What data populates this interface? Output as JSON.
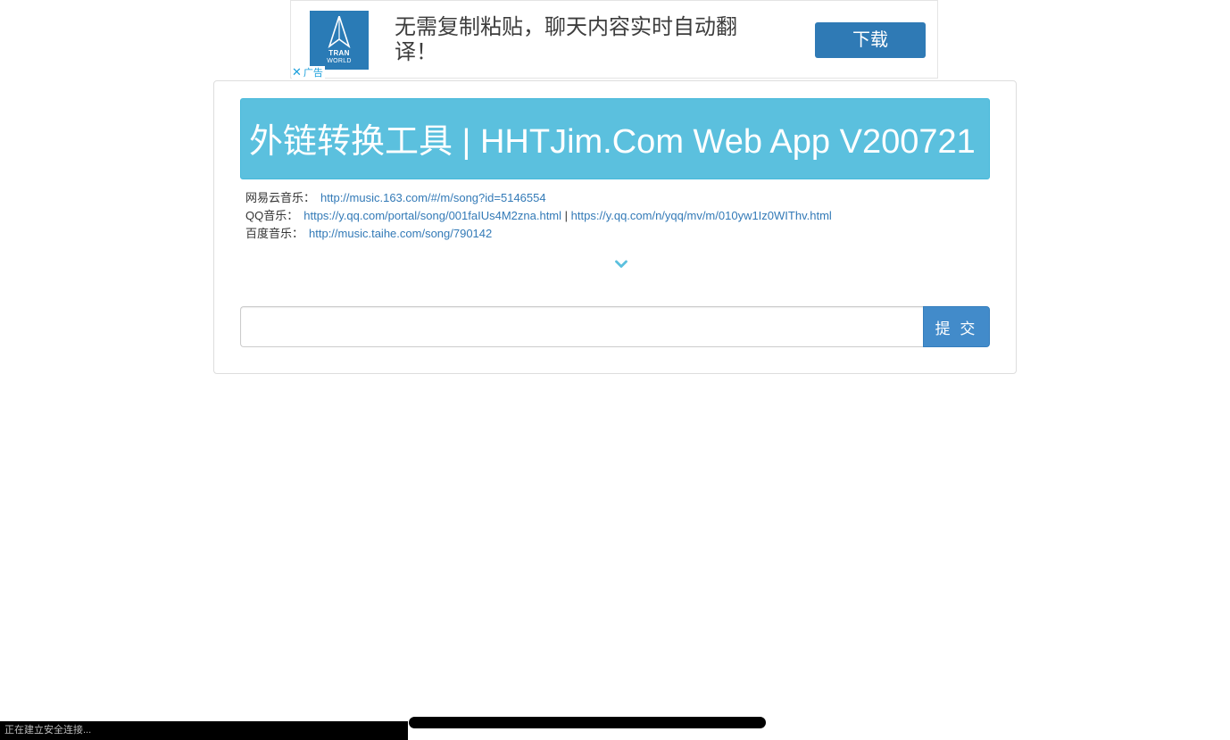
{
  "ad": {
    "logo_name": "tranworld-logo",
    "logo_line1": "TRAN",
    "logo_line2": "WORLD",
    "headline": "无需复制粘贴，聊天内容实时自动翻译！",
    "button_label": "下载",
    "ad_label": "广告",
    "close_icon": "close-icon",
    "colors": {
      "brand": "#2a7bb6",
      "button": "#2f7ab5",
      "mark": "#1a9fdc"
    }
  },
  "page": {
    "title": "外链转换工具 | HHTJim.Com Web App V200721",
    "examples": [
      {
        "label": "网易云音乐：",
        "links": [
          "http://music.163.com/#/m/song?id=5146554"
        ]
      },
      {
        "label": "QQ音乐：",
        "links": [
          "https://y.qq.com/portal/song/001faIUs4M2zna.html",
          "https://y.qq.com/n/yqq/mv/m/010yw1Iz0WIThv.html"
        ],
        "separator": "|"
      },
      {
        "label": "百度音乐：",
        "links": [
          "http://music.taihe.com/song/790142"
        ]
      }
    ],
    "expand_icon": "chevron-down-icon",
    "input": {
      "value": "",
      "placeholder": ""
    },
    "submit_label": "提 交",
    "colors": {
      "jumbotron": "#5bc0de",
      "link": "#337ab7",
      "submit": "#428bca"
    }
  },
  "browser": {
    "status_text": "正在建立安全连接..."
  }
}
